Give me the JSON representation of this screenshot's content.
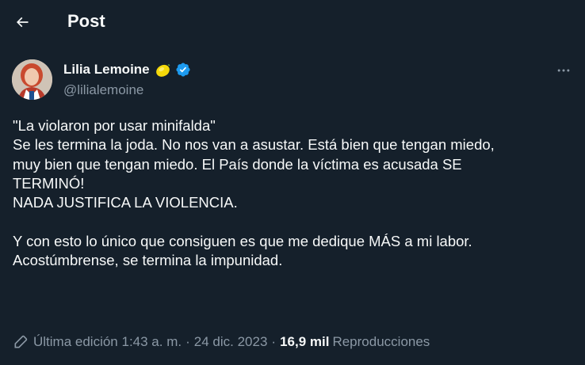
{
  "header": {
    "title": "Post",
    "back_icon": "arrow-left-icon"
  },
  "author": {
    "display_name": "Lilia Lemoine",
    "emoji": "lemon-icon",
    "verified_icon": "verified-badge-icon",
    "handle": "@lilialemoine"
  },
  "more_icon": "more-dots-icon",
  "tweet": {
    "lines": [
      "\"La violaron por usar minifalda\"",
      "Se les termina la joda. No nos van a asustar. Está bien que tengan miedo,",
      "muy bien que tengan miedo. El País donde la víctima es acusada SE",
      "TERMINÓ!",
      "NADA JUSTIFICA LA VIOLENCIA.",
      "Y con esto lo único que consiguen es que me dedique MÁS a mi labor.",
      "Acostúmbrense, se termina la impunidad."
    ]
  },
  "meta": {
    "edit_icon": "pencil-icon",
    "edited_label": "Última edición 1:43 a. m.",
    "separator": "·",
    "date": "24 dic. 2023",
    "views_count": "16,9 mil",
    "views_label": "Reproducciones"
  },
  "colors": {
    "background": "#15202b",
    "text": "#f7f9f9",
    "secondary": "#8b98a5",
    "verified": "#1d9bf0"
  }
}
